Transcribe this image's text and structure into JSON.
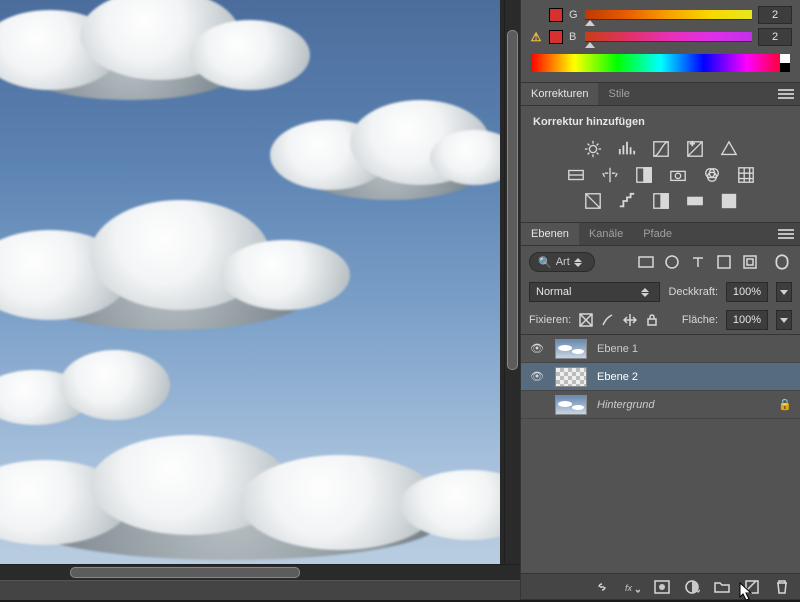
{
  "color_panel": {
    "sliders": [
      {
        "letter": "G",
        "value": "2",
        "swatch": "#d63030",
        "gradient": "linear-gradient(to right,#bd3a00,#e85d00,#f8a000,#f6d800,#e7e71f)",
        "warn": false
      },
      {
        "letter": "B",
        "value": "2",
        "swatch": "#d63030",
        "gradient": "linear-gradient(to right,#c63f15,#df3363,#e831b4,#e02fe7,#c230ea)",
        "warn": true
      }
    ]
  },
  "adjustments": {
    "tabs": [
      {
        "label": "Korrekturen",
        "active": true
      },
      {
        "label": "Stile",
        "active": false
      }
    ],
    "title": "Korrektur hinzufügen"
  },
  "layers": {
    "tabs": [
      {
        "label": "Ebenen",
        "active": true
      },
      {
        "label": "Kanäle",
        "active": false
      },
      {
        "label": "Pfade",
        "active": false
      }
    ],
    "search_kind": "Art",
    "blend_mode": "Normal",
    "opacity_label": "Deckkraft:",
    "opacity_value": "100%",
    "fill_label": "Fläche:",
    "fill_value": "100%",
    "lock_label": "Fixieren:",
    "items": [
      {
        "name": "Ebene 1",
        "visible": true,
        "thumb": "sky",
        "selected": false,
        "locked": false
      },
      {
        "name": "Ebene 2",
        "visible": true,
        "thumb": "checker",
        "selected": true,
        "locked": false
      },
      {
        "name": "Hintergrund",
        "visible": false,
        "thumb": "sky",
        "selected": false,
        "locked": true,
        "italic": true
      }
    ]
  }
}
